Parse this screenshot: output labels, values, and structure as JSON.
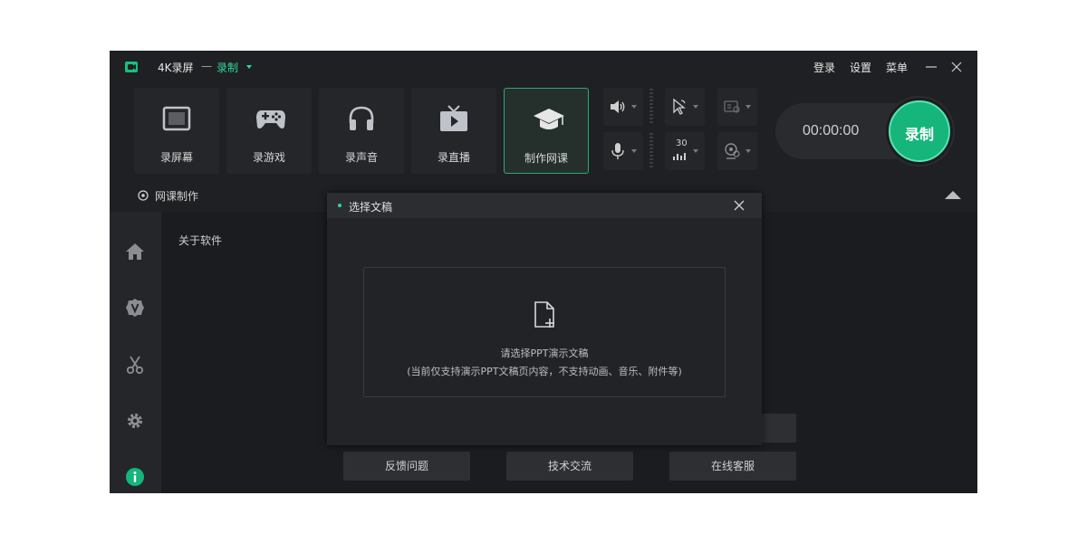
{
  "titlebar": {
    "app_name": "4K录屏",
    "separator": "一",
    "mode": "录制",
    "login": "登录",
    "settings": "设置",
    "menu": "菜单"
  },
  "toolbar": {
    "tools": [
      {
        "label": "录屏幕",
        "icon": "screen-icon"
      },
      {
        "label": "录游戏",
        "icon": "gamepad-icon"
      },
      {
        "label": "录声音",
        "icon": "headphones-icon"
      },
      {
        "label": "录直播",
        "icon": "tv-icon"
      },
      {
        "label": "制作网课",
        "icon": "graduation-cap-icon",
        "active": true
      }
    ],
    "fps": "30",
    "timer": "00:00:00",
    "record_label": "录制"
  },
  "section": {
    "label": "网课制作"
  },
  "main": {
    "about_label": "关于软件",
    "buttons": [
      "反馈问题",
      "技术交流",
      "在线客服"
    ]
  },
  "modal": {
    "title": "选择文稿",
    "line1": "请选择PPT演示文稿",
    "line2": "(当前仅支持演示PPT文稿页内容，不支持动画、音乐、附件等)"
  },
  "colors": {
    "accent": "#15b57b",
    "accent_text": "#2fd89a",
    "background": "#1f2023",
    "info": "#15b57b"
  }
}
